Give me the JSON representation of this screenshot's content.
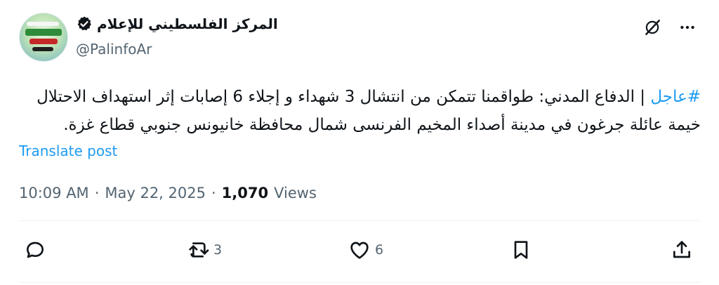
{
  "author": {
    "display_name": "المركز الفلسطيني للإعلام",
    "handle": "@PalinfoAr",
    "verified": true
  },
  "post": {
    "hashtag": "#عاجل",
    "body": " | الدفاع المدني: طواقمنا تتمكن من انتشال 3 شهداء و إجلاء 6 إصابات إثر استهداف الاحتلال خيمة عائلة جرغون في مدينة أصداء المخيم الفرنسى شمال محافظة خانيونس جنوبي قطاع غزة.",
    "translate_label": "Translate post",
    "time": "10:09 AM",
    "separator": "·",
    "date": "May 22, 2025",
    "views_count": "1,070",
    "views_label": "Views"
  },
  "actions": {
    "reply_count": "",
    "repost_count": "3",
    "like_count": "6"
  },
  "icons": {
    "more": "more-horizontal-icon",
    "grok": "grok-icon",
    "reply": "reply-icon",
    "repost": "repost-icon",
    "like": "heart-icon",
    "bookmark": "bookmark-icon",
    "share": "share-icon"
  },
  "colors": {
    "accent": "#1d9bf0",
    "text": "#0f1419",
    "secondary": "#536471"
  }
}
